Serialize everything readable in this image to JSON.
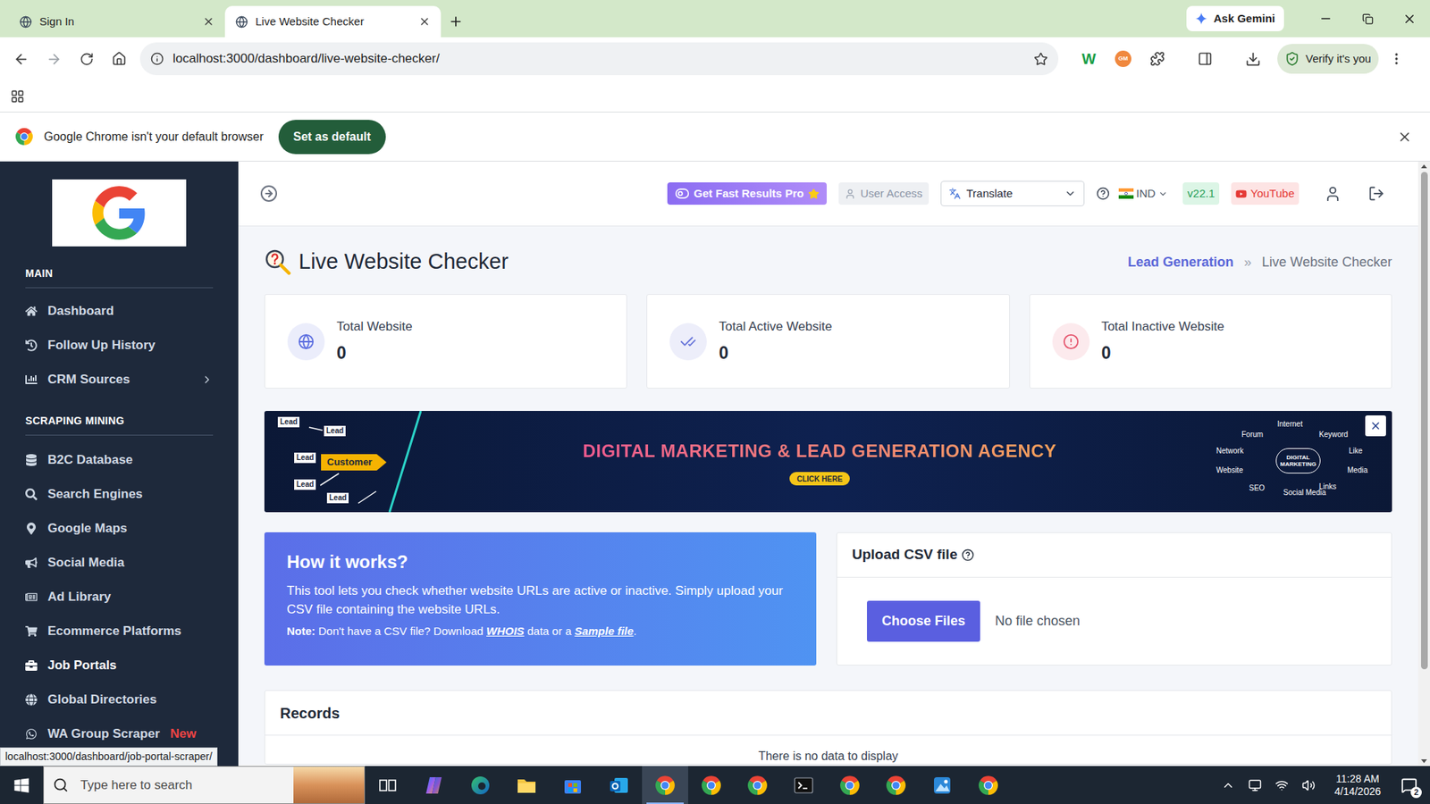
{
  "browser": {
    "tabs": [
      {
        "label": "Sign In",
        "selected": false
      },
      {
        "label": "Live Website Checker",
        "selected": true
      }
    ],
    "gemini_button": "Ask Gemini",
    "url": "localhost:3000/dashboard/live-website-checker/",
    "extensions": [
      {
        "label": "W",
        "color": "#1a9e47"
      },
      {
        "label": "GM",
        "color": "#f0883e"
      }
    ],
    "profile_button": "Verify it's you"
  },
  "infobar": {
    "message": "Google Chrome isn't your default browser",
    "button": "Set as default"
  },
  "sidebar": {
    "sections": [
      {
        "title": "MAIN",
        "items": [
          {
            "label": "Dashboard",
            "selected": false,
            "expandable": false
          },
          {
            "label": "Follow Up History",
            "selected": false,
            "expandable": false
          },
          {
            "label": "CRM Sources",
            "selected": false,
            "expandable": true
          }
        ]
      },
      {
        "title": "SCRAPING MINING",
        "items": [
          {
            "label": "B2C Database",
            "selected": false,
            "expandable": false
          },
          {
            "label": "Search Engines",
            "selected": false,
            "expandable": false
          },
          {
            "label": "Google Maps",
            "selected": false,
            "expandable": false
          },
          {
            "label": "Social Media",
            "selected": false,
            "expandable": false
          },
          {
            "label": "Ad Library",
            "selected": false,
            "expandable": false
          },
          {
            "label": "Ecommerce Platforms",
            "selected": false,
            "expandable": false
          },
          {
            "label": "Job Portals",
            "selected": true,
            "expandable": false
          },
          {
            "label": "Global Directories",
            "selected": false,
            "expandable": false
          },
          {
            "label": "WA Group Scraper",
            "selected": false,
            "expandable": false,
            "badge": "New"
          }
        ]
      }
    ]
  },
  "header": {
    "pro_button": "Get Fast Results Pro",
    "user_access": "User Access",
    "translate": "Translate",
    "country": "IND",
    "version": "v22.1",
    "youtube": "YouTube"
  },
  "page": {
    "title": "Live Website Checker",
    "breadcrumb": [
      "Lead Generation",
      "Live Website Checker"
    ],
    "breadcrumb_separator": "»"
  },
  "stats": [
    {
      "label": "Total Website",
      "value": "0",
      "color": "#5d6fe0"
    },
    {
      "label": "Total Active Website",
      "value": "0",
      "color": "#6875d9"
    },
    {
      "label": "Total Inactive Website",
      "value": "0",
      "color": "#e5556d"
    }
  ],
  "banner": {
    "headline": "DIGITAL MARKETING & LEAD GENERATION AGENCY",
    "button": "CLICK HERE",
    "left_tags": [
      "Lead",
      "Lead",
      "Lead",
      "Lead",
      "Lead"
    ],
    "left_arrow": "Customer",
    "hub": "DIGITAL MARKETING",
    "right_tags": [
      "Internet",
      "Keyword",
      "Forum",
      "Network",
      "Like",
      "Website",
      "Media",
      "SEO",
      "Social Media",
      "Links"
    ]
  },
  "how_it_works": {
    "title": "How it works?",
    "body": "This tool lets you check whether website URLs are active or inactive. Simply upload your CSV file containing the website URLs.",
    "note": [
      {
        "text": "Note:",
        "kind": "bold"
      },
      {
        "text": " Don't have a CSV file? Download ",
        "kind": "plain"
      },
      {
        "text": "WHOIS",
        "kind": "link"
      },
      {
        "text": " data or a ",
        "kind": "plain"
      },
      {
        "text": "Sample file",
        "kind": "link"
      },
      {
        "text": ".",
        "kind": "plain"
      }
    ]
  },
  "upload": {
    "title": "Upload CSV file",
    "button": "Choose Files",
    "status": "No file chosen"
  },
  "records": {
    "title": "Records",
    "empty": "There is no data to display"
  },
  "status_link": "localhost:3000/dashboard/job-portal-scraper/",
  "taskbar": {
    "search": "Type here to search",
    "apps": [
      {
        "kind": "taskview",
        "active": false
      },
      {
        "kind": "copilot",
        "active": false
      },
      {
        "kind": "edge",
        "active": false
      },
      {
        "kind": "explorer",
        "active": false
      },
      {
        "kind": "store",
        "active": false
      },
      {
        "kind": "outlook",
        "active": false
      },
      {
        "kind": "chrome",
        "active": true
      },
      {
        "kind": "chrome",
        "active": false
      },
      {
        "kind": "chrome",
        "active": false
      },
      {
        "kind": "terminal",
        "active": false
      },
      {
        "kind": "chrome",
        "active": false
      },
      {
        "kind": "chrome",
        "active": false
      },
      {
        "kind": "photos",
        "active": false
      },
      {
        "kind": "chrome",
        "active": false
      }
    ],
    "time": "11:28 AM",
    "date": "4/14/2026",
    "notifications": "2"
  }
}
